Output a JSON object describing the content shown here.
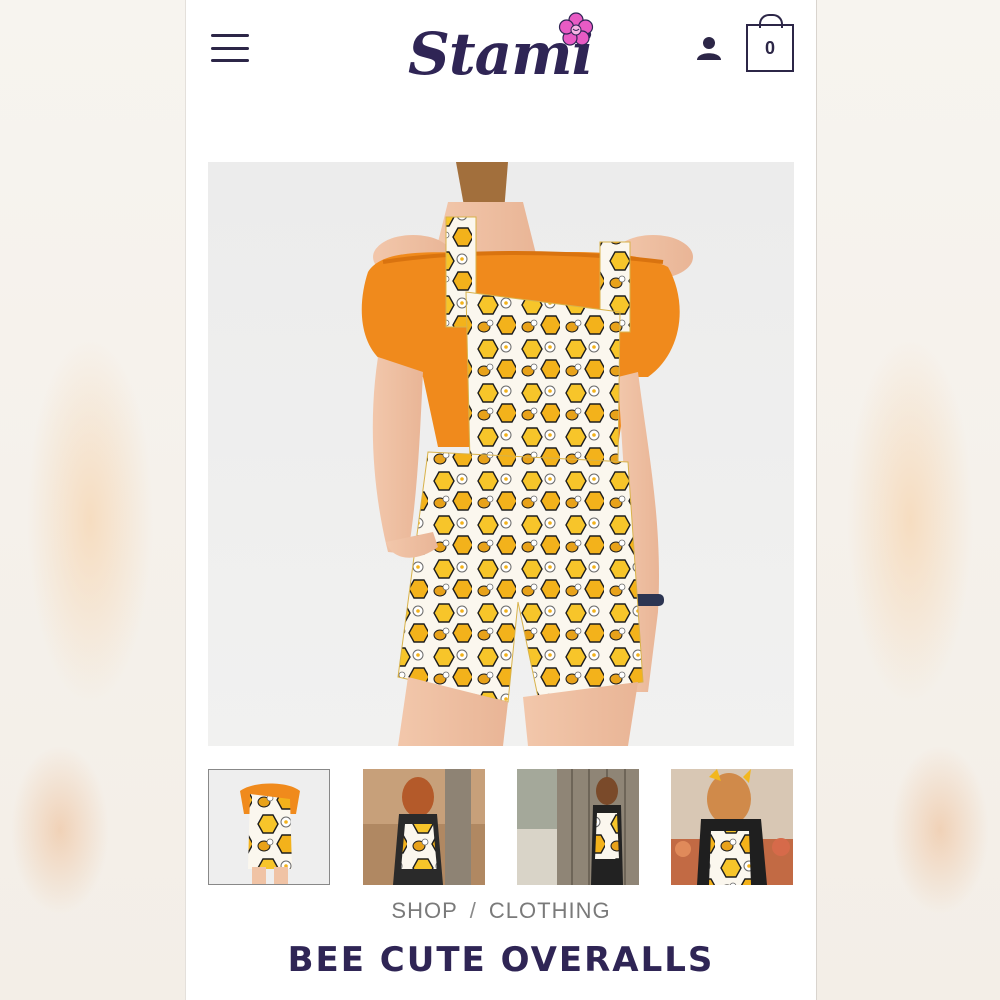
{
  "header": {
    "logo_text": "Stami",
    "cart_count": "0",
    "icons": {
      "menu": "hamburger-menu-icon",
      "account": "user-icon",
      "cart": "shopping-bag-icon",
      "logo_mark": "flower-icon"
    }
  },
  "gallery": {
    "main_image": "product-photo-bee-overalls-front",
    "thumbnails": [
      {
        "name": "front-studio",
        "active": true
      },
      {
        "name": "autumn-tree",
        "active": false
      },
      {
        "name": "wooden-fence",
        "active": false
      },
      {
        "name": "flower-garden",
        "active": false
      }
    ]
  },
  "breadcrumb": {
    "shop": "SHOP",
    "separator": "/",
    "category": "CLOTHING"
  },
  "product": {
    "title": "BEE CUTE OVERALLS"
  },
  "colors": {
    "brand": "#2f2555",
    "accent_flower": "#e85bc4",
    "overall_yellow": "#f2b71e",
    "shirt_orange": "#f08a1c"
  }
}
